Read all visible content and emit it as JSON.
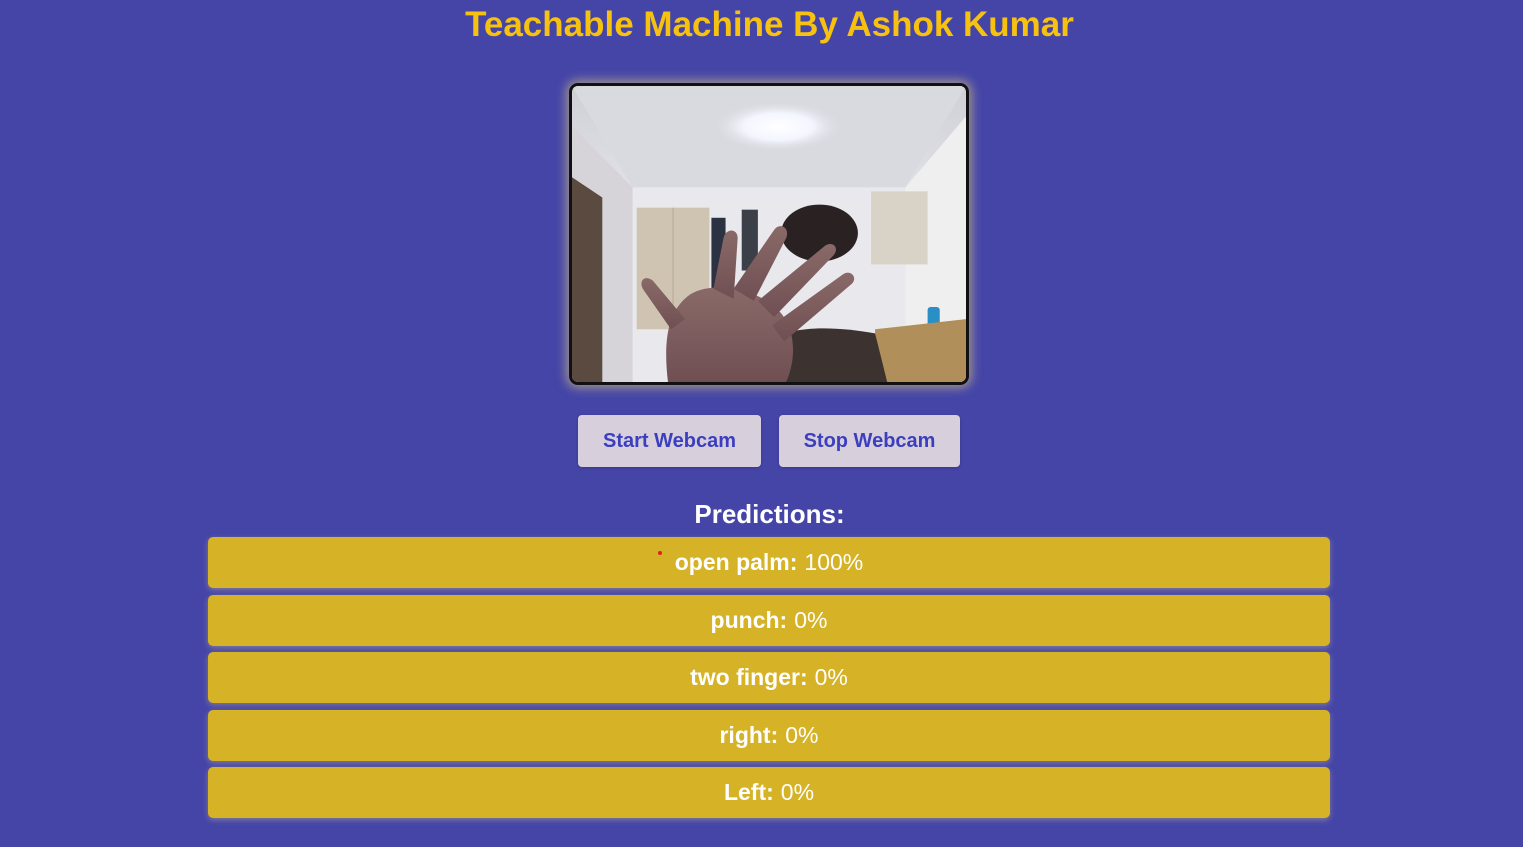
{
  "header": {
    "title": "Teachable Machine By Ashok Kumar"
  },
  "controls": {
    "start_label": "Start Webcam",
    "stop_label": "Stop Webcam"
  },
  "predictions": {
    "heading": "Predictions:",
    "items": [
      {
        "label": "open palm:",
        "value": "100%"
      },
      {
        "label": "punch:",
        "value": "0%"
      },
      {
        "label": "two finger:",
        "value": "0%"
      },
      {
        "label": "right:",
        "value": "0%"
      },
      {
        "label": "Left:",
        "value": "0%"
      }
    ]
  },
  "colors": {
    "background": "#4545a8",
    "title": "#f7c20f",
    "prediction_row": "#d6b226",
    "button_bg": "#d8cfdc",
    "button_text": "#3b3fbf"
  }
}
